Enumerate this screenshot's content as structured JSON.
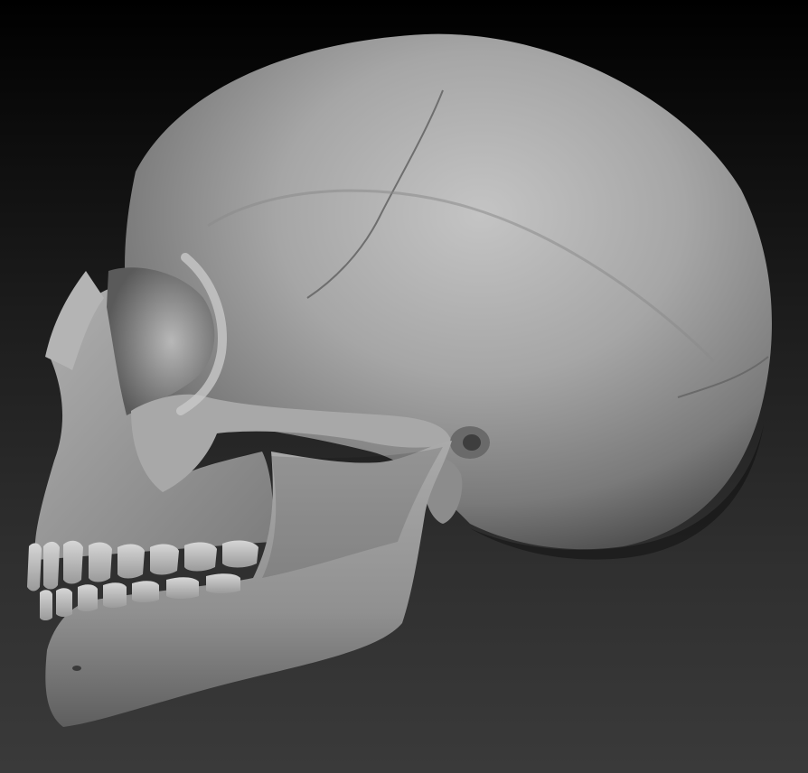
{
  "scene": {
    "subject": "skull-render",
    "background_top_color": "#000000",
    "background_bottom_color": "#3a3a3a",
    "material_color": "#9a9a9a"
  }
}
